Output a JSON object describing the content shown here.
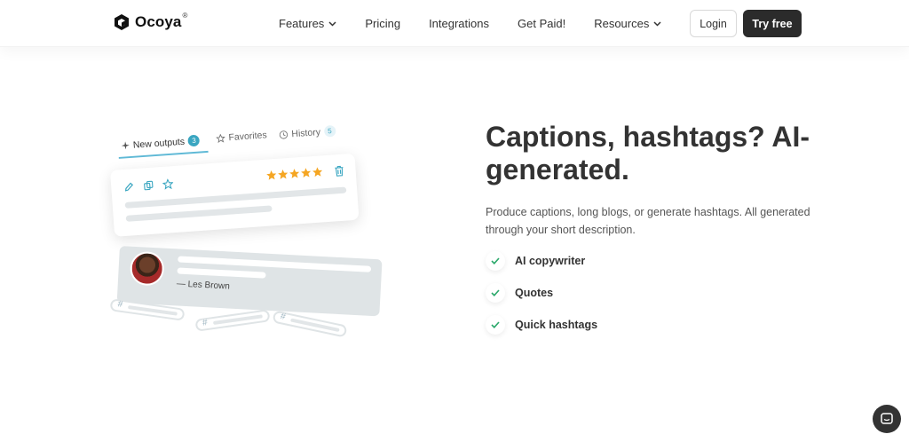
{
  "header": {
    "logo_text": "Ocoya",
    "logo_mark": "®",
    "nav": [
      "Features",
      "Pricing",
      "Integrations",
      "Get Paid!",
      "Resources"
    ],
    "login_label": "Login",
    "try_label": "Try free"
  },
  "illustration": {
    "tabs": {
      "new_outputs": "New outputs",
      "new_outputs_count": "3",
      "favorites": "Favorites",
      "history": "History",
      "history_count": "5"
    },
    "rating": 5,
    "author": "— Les Brown",
    "hashtag_symbol": "#"
  },
  "main": {
    "headline": "Captions, hashtags? AI-generated.",
    "description": "Produce captions, long blogs, or generate hashtags. All generated through your short description.",
    "features": [
      "AI copywriter",
      "Quotes",
      "Quick hashtags"
    ]
  },
  "colors": {
    "accent_teal": "#3aa6c1",
    "check_green": "#2aa86a",
    "star": "#f5a623",
    "dark_button": "#2b2b2b"
  },
  "icons": [
    "logo-icon",
    "chevron-down-icon",
    "sparkle-icon",
    "star-outline-icon",
    "clock-icon",
    "edit-icon",
    "copy-icon",
    "trash-icon",
    "check-icon",
    "chat-icon"
  ]
}
